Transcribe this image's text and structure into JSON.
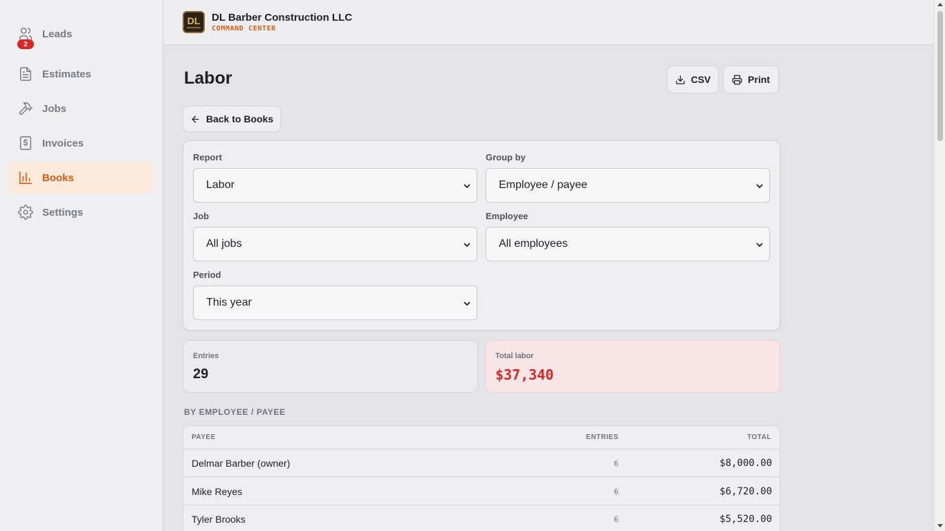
{
  "sidebar": {
    "items": [
      {
        "label": "Leads",
        "icon": "users-icon",
        "badge": "2"
      },
      {
        "label": "Estimates",
        "icon": "document-icon"
      },
      {
        "label": "Jobs",
        "icon": "hammer-icon"
      },
      {
        "label": "Invoices",
        "icon": "invoice-dollar-icon"
      },
      {
        "label": "Books",
        "icon": "bar-chart-icon",
        "active": true
      },
      {
        "label": "Settings",
        "icon": "gear-icon"
      }
    ]
  },
  "header": {
    "logo_text": "DL",
    "company": "DL Barber Construction LLC",
    "subtitle": "COMMAND CENTER"
  },
  "page": {
    "title": "Labor",
    "csv_label": "CSV",
    "print_label": "Print",
    "back_label": "Back to Books"
  },
  "filters": {
    "report": {
      "label": "Report",
      "value": "Labor"
    },
    "group_by": {
      "label": "Group by",
      "value": "Employee / payee"
    },
    "job": {
      "label": "Job",
      "value": "All jobs"
    },
    "employee": {
      "label": "Employee",
      "value": "All employees"
    },
    "period": {
      "label": "Period",
      "value": "This year"
    }
  },
  "summary": {
    "entries_label": "Entries",
    "entries_value": "29",
    "total_label": "Total labor",
    "total_value": "$37,340"
  },
  "section": {
    "heading": "BY EMPLOYEE / PAYEE"
  },
  "table": {
    "columns": [
      "PAYEE",
      "ENTRIES",
      "TOTAL"
    ],
    "rows": [
      {
        "payee": "Delmar Barber (owner)",
        "entries": "6",
        "total": "$8,000.00"
      },
      {
        "payee": "Mike Reyes",
        "entries": "6",
        "total": "$6,720.00"
      },
      {
        "payee": "Tyler Brooks",
        "entries": "6",
        "total": "$5,520.00"
      }
    ]
  },
  "colors": {
    "accent": "#d35f15",
    "danger": "#dc2626",
    "active_bg": "#fbe9db",
    "total_card_bg": "#f8e6e6"
  }
}
